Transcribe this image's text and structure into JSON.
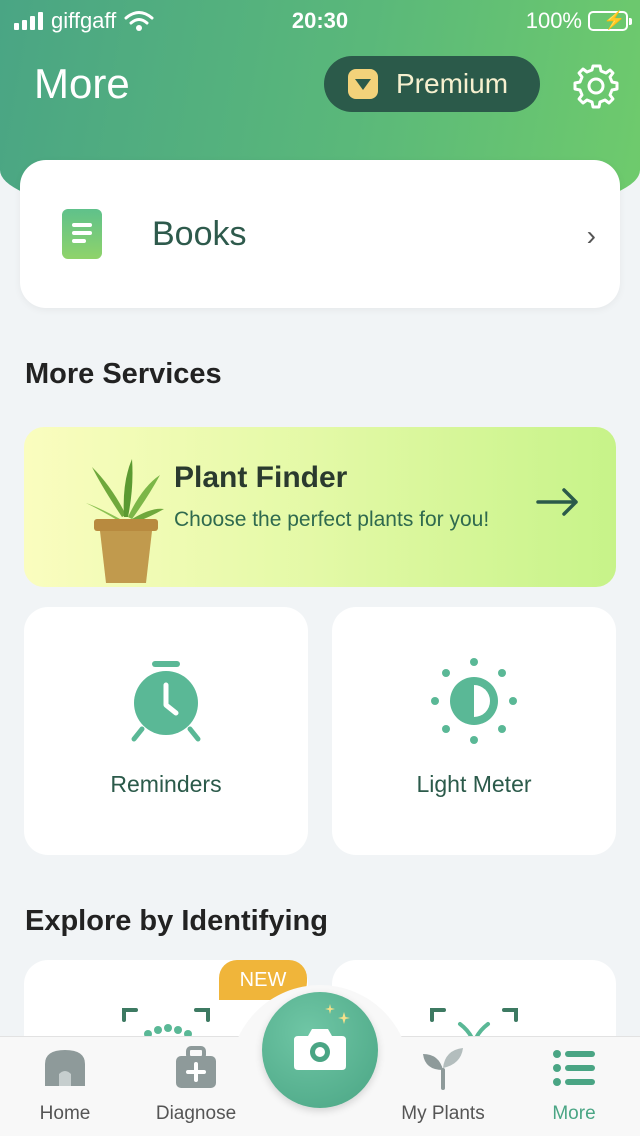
{
  "status_bar": {
    "carrier": "giffgaff",
    "time": "20:30",
    "battery": "100%"
  },
  "header": {
    "title": "More",
    "premium_label": "Premium"
  },
  "books": {
    "label": "Books"
  },
  "more_services": {
    "title": "More Services",
    "plant_finder": {
      "title": "Plant Finder",
      "description": "Choose the perfect plants for you!"
    },
    "tiles": [
      {
        "label": "Reminders",
        "icon": "alarm-clock-icon"
      },
      {
        "label": "Light Meter",
        "icon": "sun-icon"
      }
    ]
  },
  "explore": {
    "title": "Explore by Identifying",
    "badge": "NEW"
  },
  "tabbar": {
    "items": [
      {
        "label": "Home",
        "icon": "home-icon"
      },
      {
        "label": "Diagnose",
        "icon": "medical-kit-icon"
      },
      {
        "label": "My Plants",
        "icon": "sprout-icon"
      },
      {
        "label": "More",
        "icon": "list-icon"
      }
    ],
    "active": "More"
  },
  "colors": {
    "accent": "#4aa584",
    "premium_bg": "#2b5a4a",
    "badge": "#f0b53a"
  }
}
